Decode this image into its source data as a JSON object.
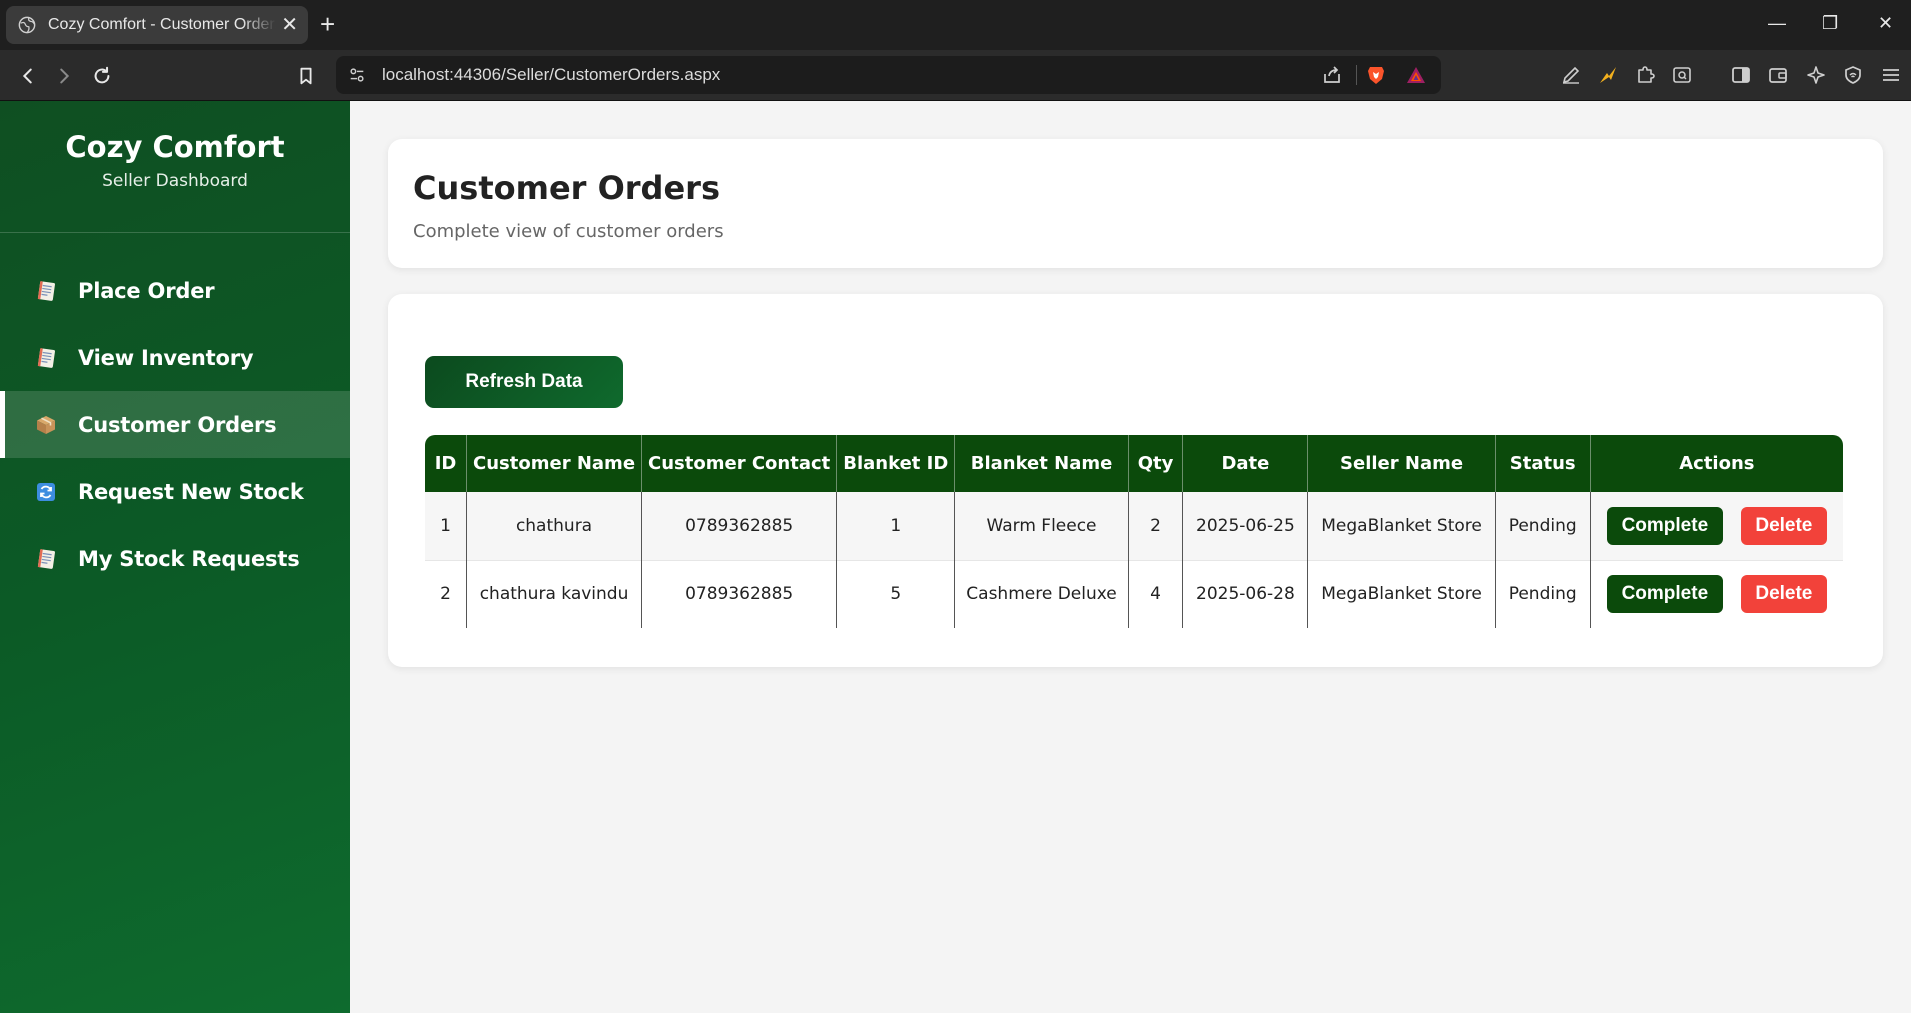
{
  "browser": {
    "tab_title": "Cozy Comfort - Customer Orders",
    "url": "localhost:44306/Seller/CustomerOrders.aspx",
    "new_tab": "+",
    "tab_close": "✕",
    "window_controls": {
      "minimize": "—",
      "restore": "❐",
      "close": "✕"
    }
  },
  "sidebar": {
    "brand_title": "Cozy Comfort",
    "brand_subtitle": "Seller Dashboard",
    "items": [
      {
        "label": "Place Order",
        "icon": "notepad-icon",
        "active": false
      },
      {
        "label": "View Inventory",
        "icon": "notepad-icon",
        "active": false
      },
      {
        "label": "Customer Orders",
        "icon": "package-icon",
        "active": true
      },
      {
        "label": "Request New Stock",
        "icon": "refresh-icon",
        "active": false
      },
      {
        "label": "My Stock Requests",
        "icon": "notepad-icon",
        "active": false
      }
    ]
  },
  "header": {
    "title": "Customer Orders",
    "subtitle": "Complete view of customer orders"
  },
  "main": {
    "refresh_label": "Refresh Data",
    "table": {
      "columns": [
        "ID",
        "Customer Name",
        "Customer Contact",
        "Blanket ID",
        "Blanket Name",
        "Qty",
        "Date",
        "Seller Name",
        "Status",
        "Actions"
      ],
      "rows": [
        {
          "id": "1",
          "customer_name": "chathura",
          "customer_contact": "0789362885",
          "blanket_id": "1",
          "blanket_name": "Warm Fleece",
          "qty": "2",
          "date": "2025-06-25",
          "seller_name": "MegaBlanket Store",
          "status": "Pending",
          "complete_label": "Complete",
          "delete_label": "Delete"
        },
        {
          "id": "2",
          "customer_name": "chathura kavindu",
          "customer_contact": "0789362885",
          "blanket_id": "5",
          "blanket_name": "Cashmere Deluxe",
          "qty": "4",
          "date": "2025-06-28",
          "seller_name": "MegaBlanket Store",
          "status": "Pending",
          "complete_label": "Complete",
          "delete_label": "Delete"
        }
      ]
    }
  },
  "colors": {
    "sidebar_green": "#0c5a26",
    "header_green": "#0b4a0b",
    "delete_red": "#f2423a",
    "page_bg": "#f4f4f4"
  }
}
